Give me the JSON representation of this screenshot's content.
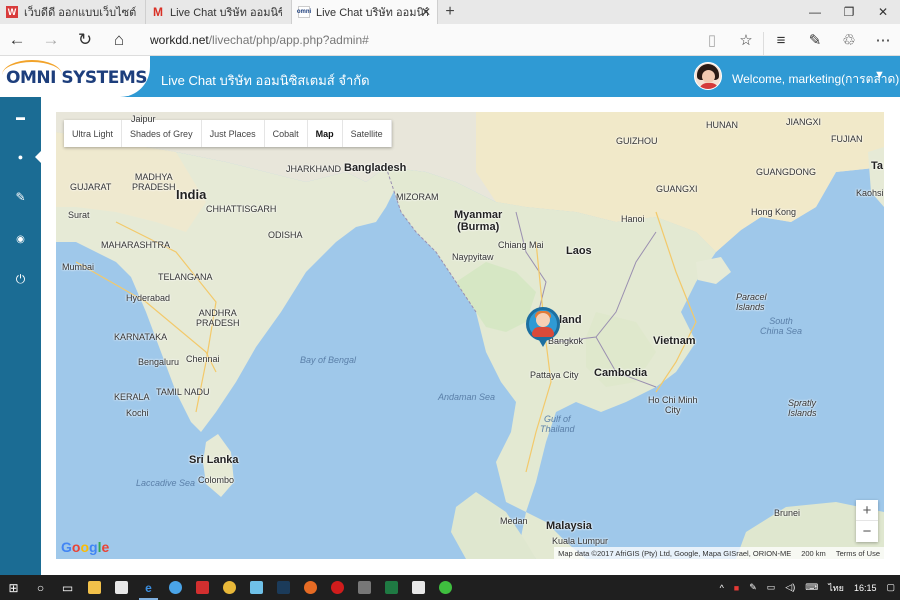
{
  "browser": {
    "tabs": [
      {
        "title": "เว็บดีดี ออกแบบเว็บไซต์ รับทำเว็บ",
        "icon": "webdd-icon",
        "color": "#d83b3b",
        "active": false
      },
      {
        "title": "Live Chat บริษัท ออมนิซิสเตมส์",
        "icon": "gmail-icon",
        "color": "#d93025",
        "active": false
      },
      {
        "title": "Live Chat บริษัท ออมนิซิสเ",
        "icon": "omni-icon",
        "color": "#1d3e7c",
        "active": true
      }
    ],
    "url_host": "workdd.net",
    "url_path": "/livechat/php/app.php?admin#"
  },
  "app": {
    "logo_text": "OMNI SYSTEMS",
    "title": "Live Chat บริษัท ออมนิซิสเตมส์ จำกัด",
    "welcome": "Welcome, marketing(การตลาด)",
    "brand_color": "#2f9ad4",
    "sidebar_color": "#1b6c94"
  },
  "sidebar": {
    "items": [
      {
        "icon": "chat-icon",
        "glyph": "▬"
      },
      {
        "icon": "map-marker-icon",
        "glyph": "●",
        "active": true
      },
      {
        "icon": "wrench-icon",
        "glyph": "✎"
      },
      {
        "icon": "eye-icon",
        "glyph": "◉"
      },
      {
        "icon": "power-icon",
        "glyph": "⏻"
      }
    ]
  },
  "map": {
    "types": [
      "Ultra Light",
      "Shades of Grey",
      "Just Places",
      "Cobalt",
      "Map",
      "Satellite"
    ],
    "selected_type": "Map",
    "zoom_in": "+",
    "zoom_out": "−",
    "google": "Google",
    "attribution": "Map data ©2017 AfriGIS (Pty) Ltd, Google, Mapa GISrael, ORION-ME",
    "scale": "200 km",
    "terms": "Terms of Use",
    "labels": {
      "jaipur": "Jaipur",
      "india": "India",
      "bangladesh": "Bangladesh",
      "myanmar": "Myanmar\n(Burma)",
      "laos": "Laos",
      "hanoi": "Hanoi",
      "hongkong": "Hong Kong",
      "taiwan": "Ta",
      "kaohsiung": "Kaohsi",
      "surat": "Surat",
      "mumbai": "Mumbai",
      "hyderabad": "Hyderabad",
      "karnataka": "KARNATAKA",
      "bengaluru": "Bengaluru",
      "chennai": "Chennai",
      "kochi": "Kochi",
      "srilanka": "Sri Lanka",
      "colombo": "Colombo",
      "bay_bengal": "Bay of Bengal",
      "andaman": "Andaman Sea",
      "laccadive": "Laccadive Sea",
      "chiangmai": "Chiang Mai",
      "bangkok": "Bangkok",
      "pattaya": "Pattaya City",
      "cambodia": "Cambodia",
      "vietnam": "Vietnam",
      "hochiminh": "Ho Chi Minh\nCity",
      "gulf_thailand": "Gulf of\nThailand",
      "south_china_sea": "South\nChina Sea",
      "paracel": "Paracel\nIslands",
      "spratly": "Spratly\nIslands",
      "malaysia": "Malaysia",
      "kualalumpur": "Kuala Lumpur",
      "medan": "Medan",
      "brunei": "Brunei",
      "madhya": "MADHYA\nPRADESH",
      "gujarat": "GUJARAT",
      "maharashtra": "MAHARASHTRA",
      "telangana": "TELANGANA",
      "andhra": "ANDHRA\nPRADESH",
      "tamilnadu": "TAMIL NADU",
      "kerala": "KERALA",
      "odisha": "ODISHA",
      "chhattisgarh": "CHHATTISGARH",
      "jharkhand": "JHARKHAND",
      "mizoram": "MIZORAM",
      "naypyitaw": "Naypyitaw",
      "guangdong": "GUANGDONG",
      "guangxi": "GUANGXI",
      "jiangxi": "JIANGXI",
      "hunan": "HUNAN",
      "guizhou": "GUIZHOU",
      "fujian": "FUJIAN",
      "thailand_fragment": "land"
    }
  },
  "taskbar": {
    "lang": "ไทย",
    "time": "16:15"
  }
}
